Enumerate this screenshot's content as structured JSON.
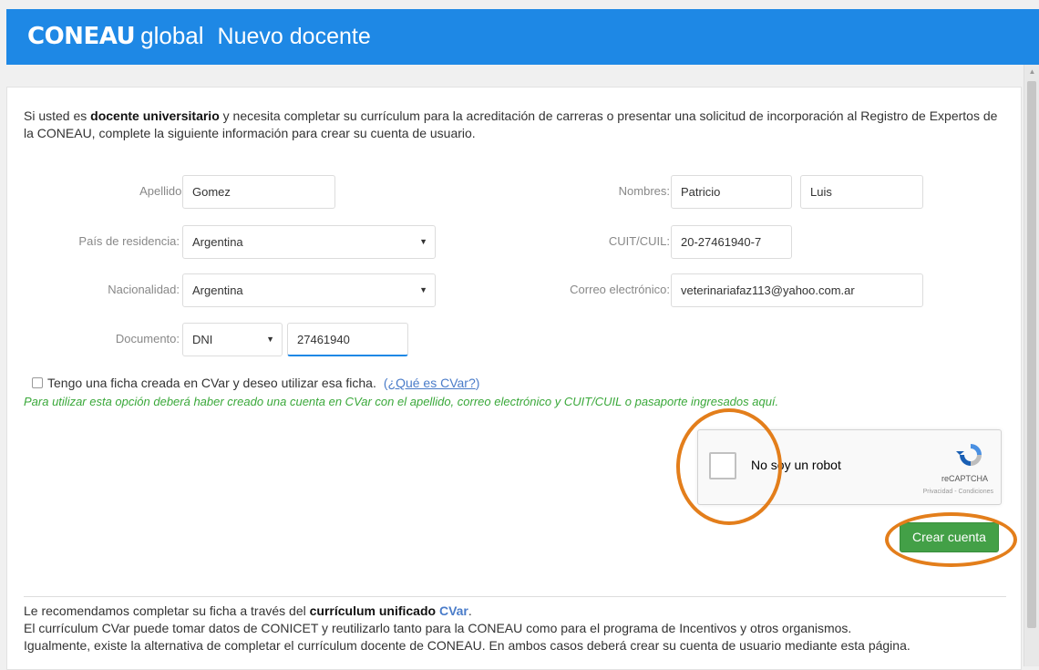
{
  "header": {
    "brand_name": "CONEAU",
    "brand_suffix": "global",
    "page_title": "Nuevo docente"
  },
  "intro": {
    "text_before": "Si usted es ",
    "bold": "docente universitario",
    "text_after": " y necesita completar su currículum para la acreditación de carreras o presentar una solicitud de incorporación al Registro de Expertos de la CONEAU, complete la siguiente información para crear su cuenta de usuario."
  },
  "form": {
    "apellido": {
      "label": "Apellido:",
      "value": "Gomez"
    },
    "nombres": {
      "label": "Nombres:",
      "value1": "Patricio",
      "value2": "Luis"
    },
    "pais": {
      "label": "País de residencia:",
      "value": "Argentina"
    },
    "cuit": {
      "label": "CUIT/CUIL:",
      "value": "20-27461940-7"
    },
    "nacionalidad": {
      "label": "Nacionalidad:",
      "value": "Argentina"
    },
    "correo": {
      "label": "Correo electrónico:",
      "value": "veterinariafaz113@yahoo.com.ar"
    },
    "documento": {
      "label": "Documento:",
      "type_value": "DNI",
      "number_value": "27461940"
    }
  },
  "cvar": {
    "checkbox_label": "Tengo una ficha creada en CVar y deseo utilizar esa ficha.",
    "link_open": "(",
    "link_text": "¿Qué es CVar?",
    "link_close": ")",
    "note": "Para utilizar esta opción deberá haber creado una cuenta en CVar con el apellido, correo electrónico y CUIT/CUIL o pasaporte ingresados aquí."
  },
  "recaptcha": {
    "label": "No soy un robot",
    "brand": "reCAPTCHA",
    "terms": "Privacidad - Condiciones"
  },
  "actions": {
    "create_account": "Crear cuenta"
  },
  "footer": {
    "line1_before": "Le recomendamos completar su ficha a través del ",
    "line1_bold": "currículum unificado",
    "line1_brand": "CVar",
    "line1_after": ".",
    "line2": "El currículum CVar puede tomar datos de CONICET y reutilizarlo tanto para la CONEAU como para el programa de Incentivos y otros organismos.",
    "line3": "Igualmente, existe la alternativa de completar el currículum docente de CONEAU. En ambos casos deberá crear su cuenta de usuario mediante esta página."
  },
  "colors": {
    "header_blue": "#1e88e5",
    "button_green": "#43a047",
    "note_green": "#3aa83a",
    "link_blue": "#4a7cc9",
    "annotation_orange": "#e37e1b"
  }
}
